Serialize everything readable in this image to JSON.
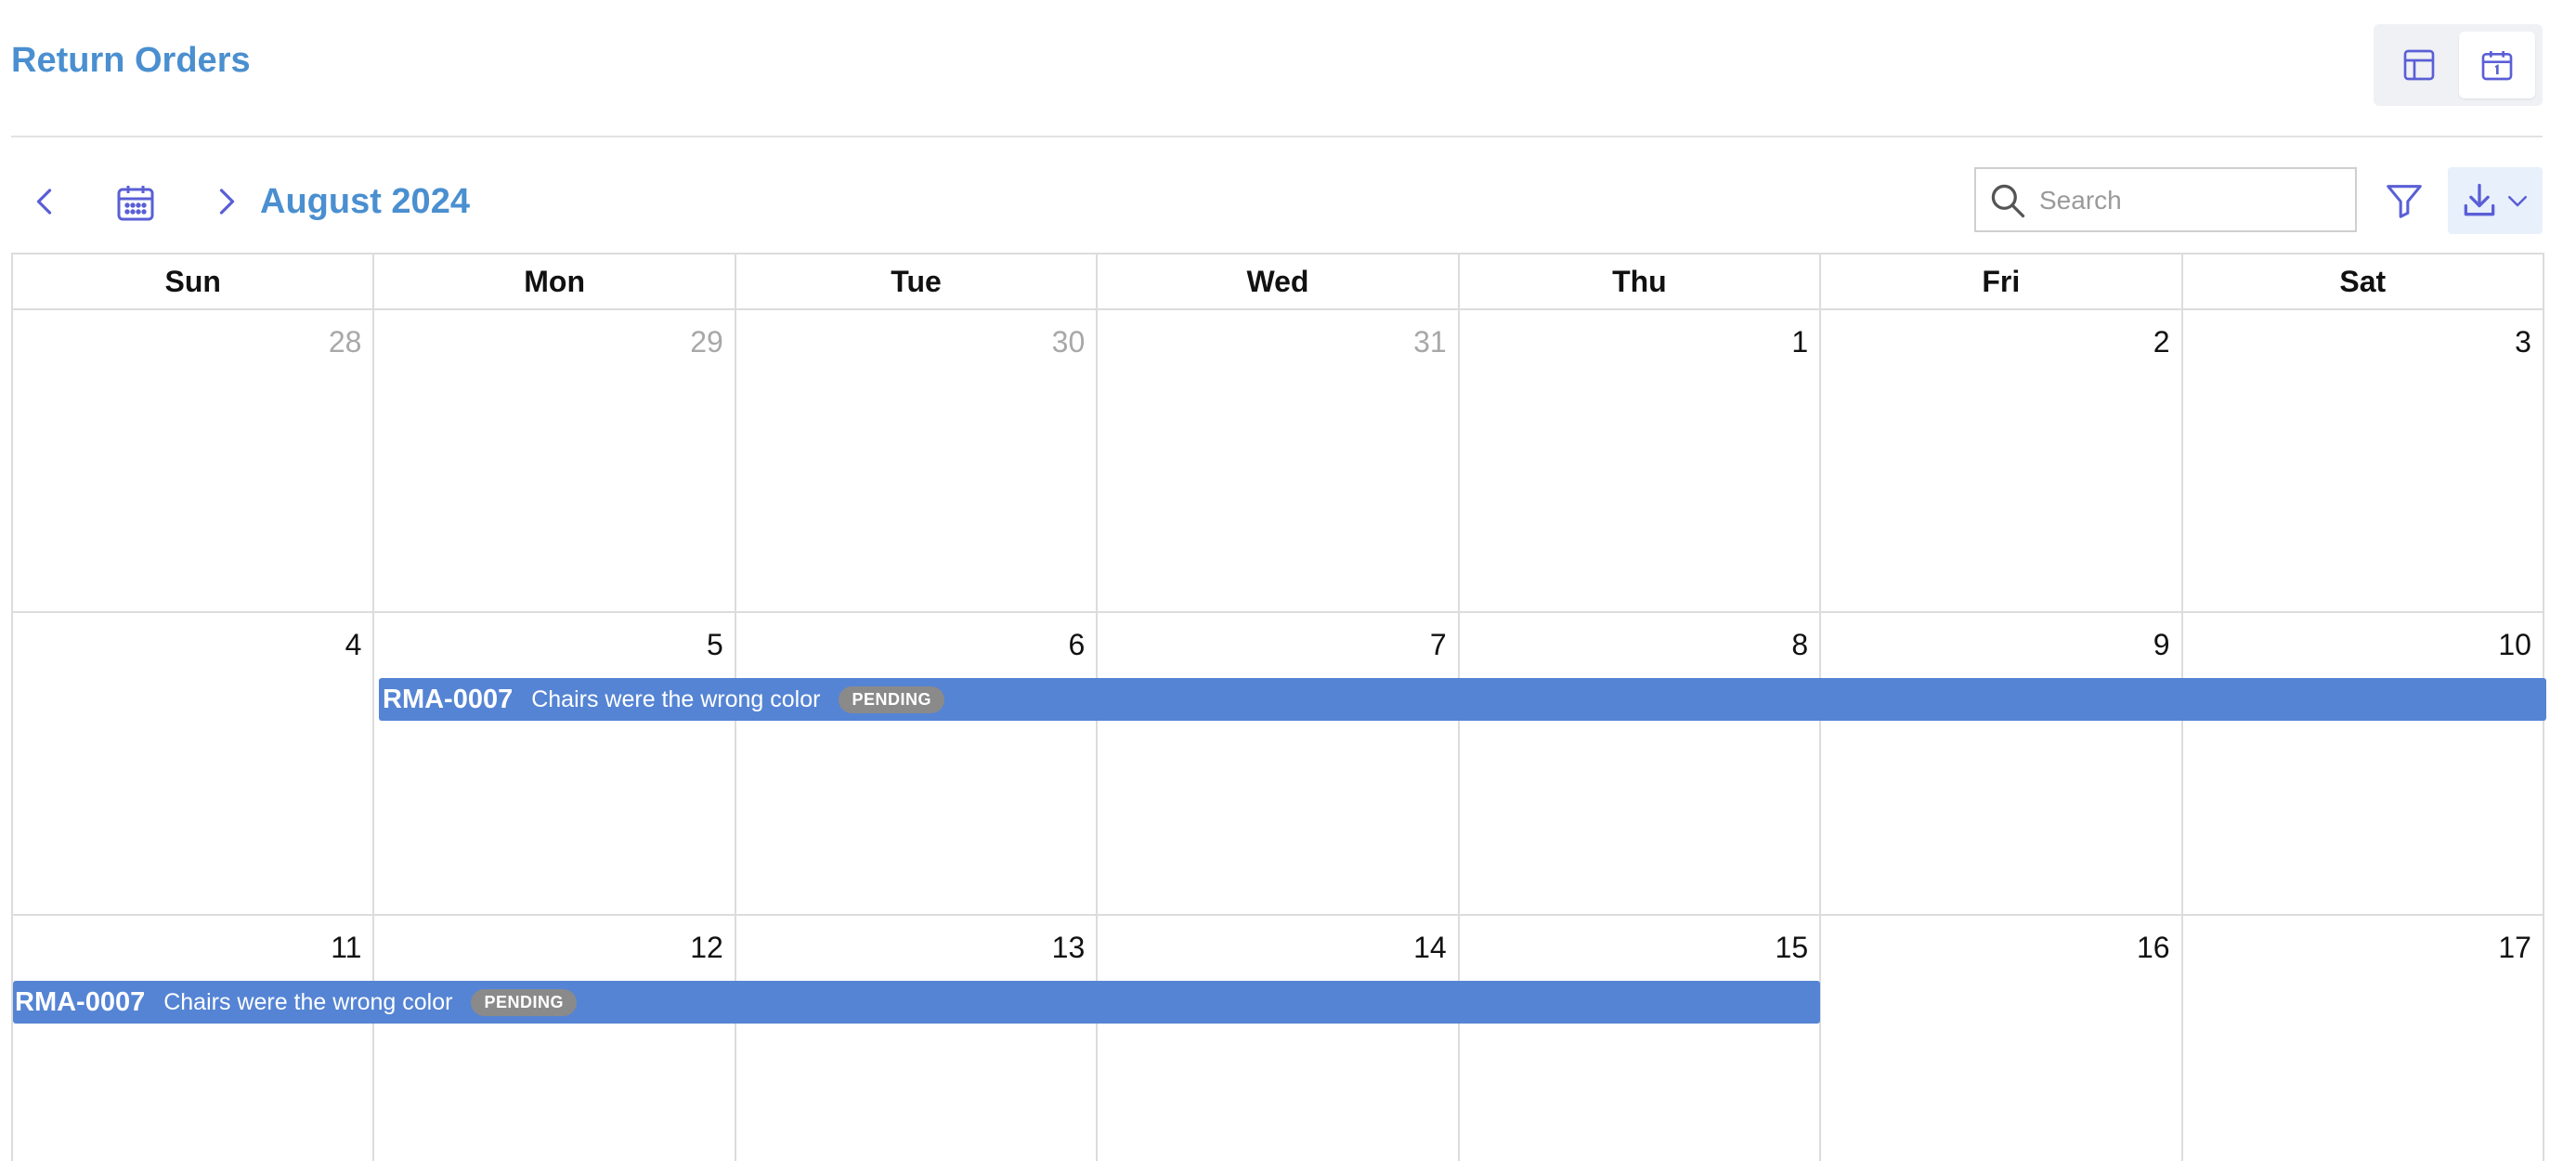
{
  "header": {
    "title": "Return Orders",
    "views": [
      {
        "name": "table-view",
        "icon": "table-grid-icon",
        "active": false
      },
      {
        "name": "calendar-view",
        "icon": "calendar-icon",
        "active": true
      }
    ]
  },
  "toolbar": {
    "month_label": "August 2024",
    "search": {
      "placeholder": "Search",
      "value": ""
    },
    "icons": {
      "prev": "chevron-left-icon",
      "today": "calendar-icon",
      "next": "chevron-right-icon",
      "filter": "filter-icon",
      "download": "download-icon"
    }
  },
  "calendar": {
    "weekdays": [
      "Sun",
      "Mon",
      "Tue",
      "Wed",
      "Thu",
      "Fri",
      "Sat"
    ],
    "weeks": [
      {
        "days": [
          {
            "num": "28",
            "muted": true
          },
          {
            "num": "29",
            "muted": true
          },
          {
            "num": "30",
            "muted": true
          },
          {
            "num": "31",
            "muted": true
          },
          {
            "num": "1",
            "muted": false
          },
          {
            "num": "2",
            "muted": false
          },
          {
            "num": "3",
            "muted": false
          }
        ]
      },
      {
        "days": [
          {
            "num": "4",
            "muted": false
          },
          {
            "num": "5",
            "muted": false
          },
          {
            "num": "6",
            "muted": false
          },
          {
            "num": "7",
            "muted": false
          },
          {
            "num": "8",
            "muted": false
          },
          {
            "num": "9",
            "muted": false
          },
          {
            "num": "10",
            "muted": false
          }
        ]
      },
      {
        "days": [
          {
            "num": "11",
            "muted": false
          },
          {
            "num": "12",
            "muted": false
          },
          {
            "num": "13",
            "muted": false
          },
          {
            "num": "14",
            "muted": false
          },
          {
            "num": "15",
            "muted": false
          },
          {
            "num": "16",
            "muted": false
          },
          {
            "num": "17",
            "muted": false
          }
        ]
      }
    ],
    "events": [
      {
        "id": "RMA-0007",
        "description": "Chairs were the wrong color",
        "status": "PENDING"
      },
      {
        "id": "RMA-0007",
        "description": "Chairs were the wrong color",
        "status": "PENDING"
      }
    ]
  },
  "colors": {
    "accent": "#4a8fd0",
    "icon": "#5a5fd6",
    "event_bar": "#5584d4",
    "status_badge": "#8a8a8a",
    "grid_line": "#dcdcdc"
  }
}
